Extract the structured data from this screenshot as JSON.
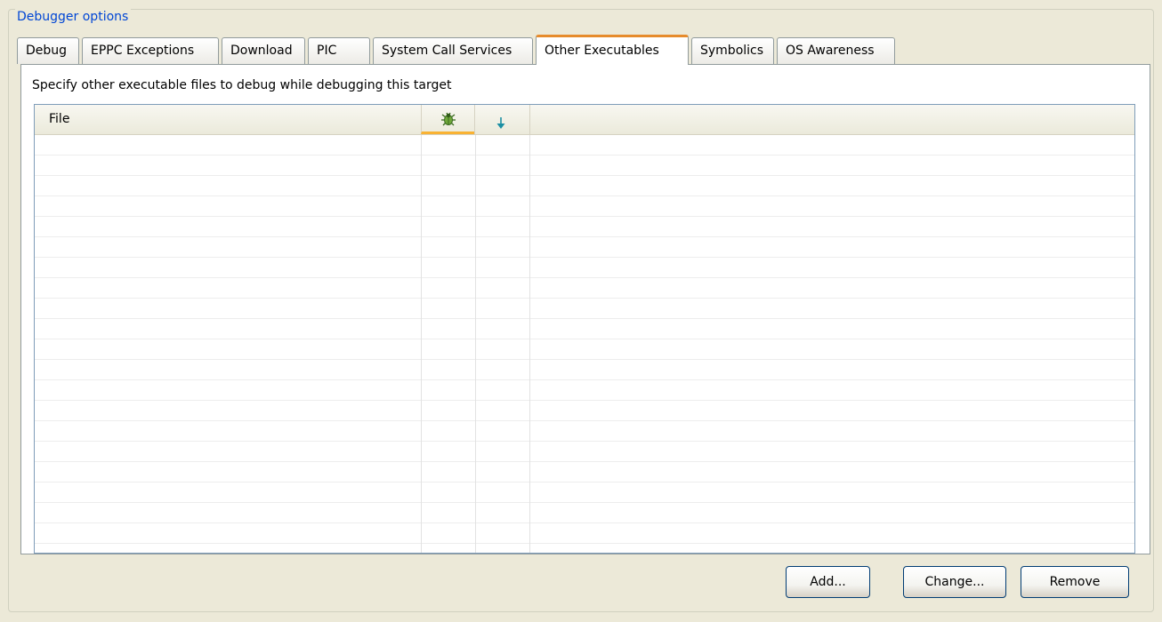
{
  "group": {
    "title": "Debugger options"
  },
  "tabs": [
    {
      "label": "Debug",
      "active": false
    },
    {
      "label": "EPPC Exceptions",
      "active": false
    },
    {
      "label": "Download",
      "active": false
    },
    {
      "label": "PIC",
      "active": false
    },
    {
      "label": "System Call Services",
      "active": false
    },
    {
      "label": "Other Executables",
      "active": true
    },
    {
      "label": "Symbolics",
      "active": false
    },
    {
      "label": "OS Awareness",
      "active": false
    }
  ],
  "panel": {
    "hint": "Specify other executable files to debug while debugging this target"
  },
  "table": {
    "columns": [
      {
        "label": "File"
      },
      {
        "icon": "debug-bug-icon"
      },
      {
        "icon": "download-arrow-icon"
      },
      {
        "label": ""
      }
    ],
    "rows": []
  },
  "buttons": {
    "add": "Add...",
    "change": "Change...",
    "remove": "Remove"
  },
  "colors": {
    "background": "#ECE9D8",
    "group_title": "#0046D5",
    "active_tab_accent": "#E68B2C",
    "sorted_column_accent": "#F9B233",
    "button_border": "#003C74"
  }
}
